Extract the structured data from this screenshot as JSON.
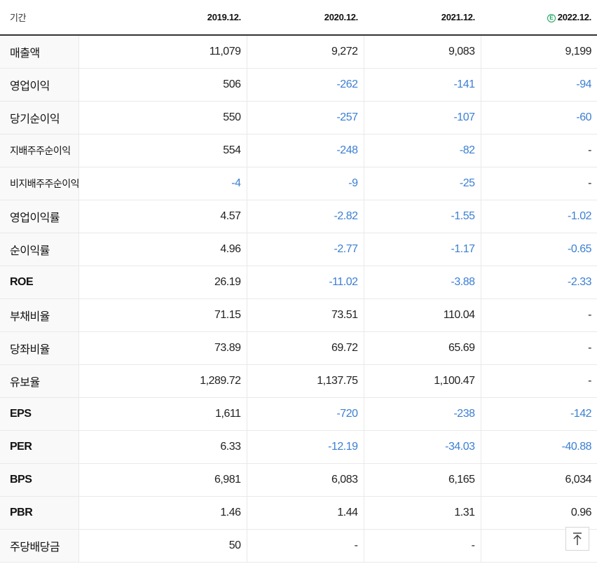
{
  "header": {
    "label": "기간",
    "periods": [
      "2019.12.",
      "2020.12.",
      "2021.12.",
      "2022.12."
    ],
    "estimate_badge": "E"
  },
  "colors": {
    "negative": "#3b7fd2",
    "estimate": "#19a35a"
  },
  "rows": [
    {
      "label": "매출액",
      "values": [
        "11,079",
        "9,272",
        "9,083",
        "9,199"
      ]
    },
    {
      "label": "영업이익",
      "values": [
        "506",
        "-262",
        "-141",
        "-94"
      ]
    },
    {
      "label": "당기순이익",
      "values": [
        "550",
        "-257",
        "-107",
        "-60"
      ]
    },
    {
      "label": "지배주주순이익",
      "values": [
        "554",
        "-248",
        "-82",
        "-"
      ]
    },
    {
      "label": "비지배주주순이익",
      "values": [
        "-4",
        "-9",
        "-25",
        "-"
      ]
    },
    {
      "label": "영업이익률",
      "values": [
        "4.57",
        "-2.82",
        "-1.55",
        "-1.02"
      ]
    },
    {
      "label": "순이익률",
      "values": [
        "4.96",
        "-2.77",
        "-1.17",
        "-0.65"
      ]
    },
    {
      "label": "ROE",
      "values": [
        "26.19",
        "-11.02",
        "-3.88",
        "-2.33"
      ]
    },
    {
      "label": "부채비율",
      "values": [
        "71.15",
        "73.51",
        "110.04",
        "-"
      ]
    },
    {
      "label": "당좌비율",
      "values": [
        "73.89",
        "69.72",
        "65.69",
        "-"
      ]
    },
    {
      "label": "유보율",
      "values": [
        "1,289.72",
        "1,137.75",
        "1,100.47",
        "-"
      ]
    },
    {
      "label": "EPS",
      "values": [
        "1,611",
        "-720",
        "-238",
        "-142"
      ]
    },
    {
      "label": "PER",
      "values": [
        "6.33",
        "-12.19",
        "-34.03",
        "-40.88"
      ]
    },
    {
      "label": "BPS",
      "values": [
        "6,981",
        "6,083",
        "6,165",
        "6,034"
      ]
    },
    {
      "label": "PBR",
      "values": [
        "1.46",
        "1.44",
        "1.31",
        "0.96"
      ]
    },
    {
      "label": "주당배당금",
      "values": [
        "50",
        "-",
        "-",
        ""
      ]
    }
  ],
  "scroll_top_icon": "arrow-up-icon"
}
